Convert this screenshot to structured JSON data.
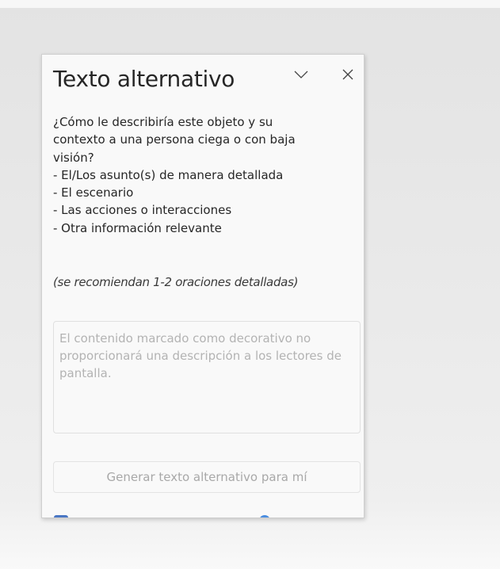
{
  "pane": {
    "title": "Texto alternativo",
    "collapse_icon": "chevron-down-icon",
    "close_icon": "close-icon",
    "description_lines": [
      "¿Cómo le describiría este objeto y su",
      "contexto a una persona ciega o con baja",
      "visión?",
      "- El/Los asunto(s) de manera detallada",
      "- El escenario",
      "- Las acciones o interacciones",
      "- Otra información relevante"
    ],
    "hint": "(se recomiendan 1-2 oraciones detalladas)",
    "alt_text_input": {
      "value": "",
      "placeholder": "El contenido marcado como decorativo no proporcionará una descripción a los lectores de pantalla."
    },
    "generate_button_label": "Generar texto alternativo para mí",
    "colors": {
      "checkbox_accent": "#4a77c4",
      "info_accent": "#4a8de0"
    }
  }
}
